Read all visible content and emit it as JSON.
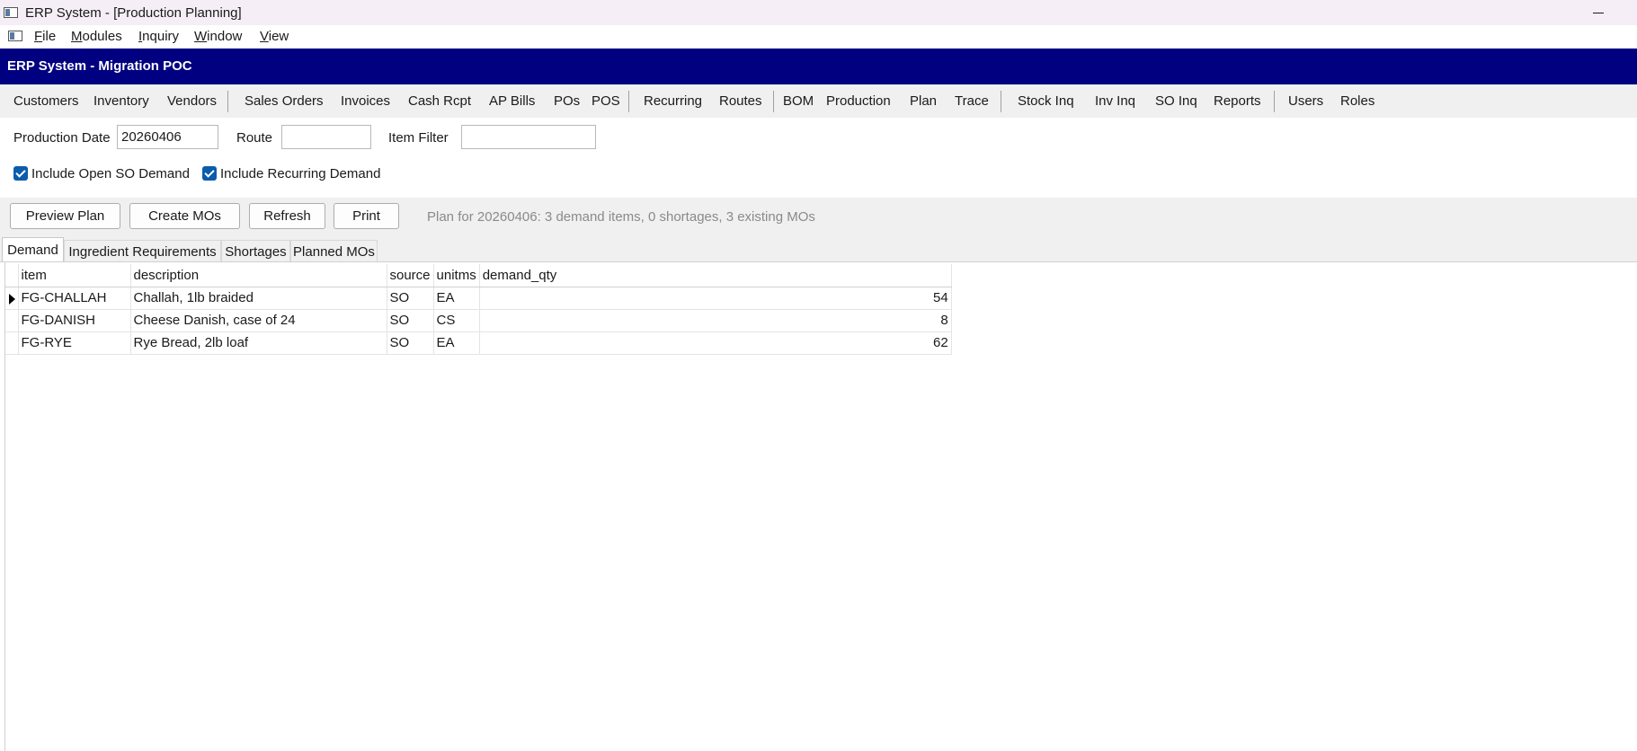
{
  "window": {
    "title": "ERP System - [Production Planning]"
  },
  "menu": {
    "items": [
      {
        "acc": "F",
        "rest": "ile"
      },
      {
        "acc": "M",
        "rest": "odules"
      },
      {
        "acc": "I",
        "rest": "nquiry"
      },
      {
        "acc": "W",
        "rest": "indow"
      },
      {
        "acc": "V",
        "rest": "iew"
      }
    ]
  },
  "banner": {
    "title": "ERP System - Migration POC"
  },
  "modules": {
    "items": [
      "Customers",
      "Inventory",
      "Vendors",
      "Sales Orders",
      "Invoices",
      "Cash Rcpt",
      "AP Bills",
      "POs",
      "POS",
      "Recurring",
      "Routes",
      "BOM",
      "Production",
      "Plan",
      "Trace",
      "Stock Inq",
      "Inv Inq",
      "SO Inq",
      "Reports",
      "Users",
      "Roles"
    ]
  },
  "filters": {
    "production_date_label": "Production Date",
    "production_date_value": "20260406",
    "route_label": "Route",
    "route_value": "",
    "item_filter_label": "Item Filter",
    "item_filter_value": "",
    "include_open_so_label": "Include Open SO Demand",
    "include_open_so_checked": true,
    "include_recurring_label": "Include Recurring Demand",
    "include_recurring_checked": true
  },
  "actions": {
    "preview_plan": "Preview Plan",
    "create_mos": "Create MOs",
    "refresh": "Refresh",
    "print": "Print",
    "status": "Plan for 20260406: 3 demand items, 0 shortages, 3 existing MOs"
  },
  "tabs": {
    "items": [
      "Demand",
      "Ingredient Requirements",
      "Shortages",
      "Planned MOs"
    ],
    "active": "Demand"
  },
  "grid": {
    "columns": [
      "item",
      "description",
      "source",
      "unitms",
      "demand_qty"
    ],
    "rows": [
      {
        "item": "FG-CHALLAH",
        "description": "Challah, 1lb braided",
        "source": "SO",
        "unitms": "EA",
        "demand_qty": "54",
        "current": true
      },
      {
        "item": "FG-DANISH",
        "description": "Cheese Danish, case of 24",
        "source": "SO",
        "unitms": "CS",
        "demand_qty": "8",
        "current": false
      },
      {
        "item": "FG-RYE",
        "description": "Rye Bread, 2lb loaf",
        "source": "SO",
        "unitms": "EA",
        "demand_qty": "62",
        "current": false
      }
    ]
  }
}
